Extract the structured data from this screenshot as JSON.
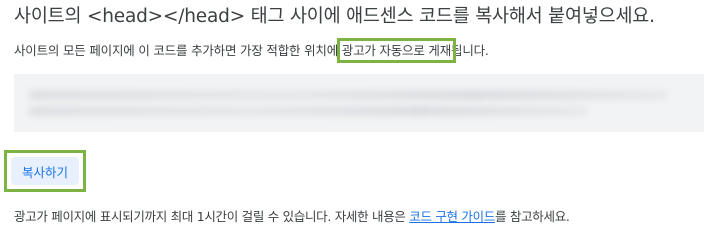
{
  "heading": "사이트의 <head></head> 태그 사이에 애드센스 코드를 복사해서 붙여넣으세요.",
  "subtext": {
    "before": "사이트의 모든 페이지에 이 코드를 추가하면 가장 적합한 위치에 ",
    "highlighted": "광고가 자동으로 게재",
    "after": "됩니다."
  },
  "copy_button": {
    "label": "복사하기"
  },
  "footnote": {
    "before": "광고가 페이지에 표시되기까지 최대 1시간이 걸릴 수 있습니다. 자세한 내용은 ",
    "link": "코드 구현 가이드",
    "after": "를 참고하세요."
  },
  "colors": {
    "highlight_border": "#7cb342",
    "link": "#1a73e8",
    "button_bg": "#e8f0fe",
    "code_bg": "#f1f3f4"
  }
}
